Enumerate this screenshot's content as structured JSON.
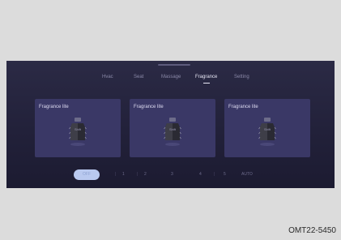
{
  "tabs": [
    {
      "label": "Hvac"
    },
    {
      "label": "Seat"
    },
    {
      "label": "Massage"
    },
    {
      "label": "Fragrance"
    },
    {
      "label": "Setting"
    }
  ],
  "active_tab": "Fragrance",
  "cards": [
    {
      "title": "Fragrance lite",
      "bottle_label": "Shift"
    },
    {
      "title": "Fragrance lite",
      "bottle_label": "Shift"
    },
    {
      "title": "Fragrance lite",
      "bottle_label": "Shift"
    }
  ],
  "levels": {
    "selected": "OFF",
    "items": [
      "1",
      "2",
      "3",
      "4",
      "5",
      "AUTO"
    ]
  },
  "figure_code": "OMT22-5450",
  "colors": {
    "screen_bg": "#25243d",
    "card_bg": "#3a3866",
    "selected_pill": "#b9c9ef"
  }
}
